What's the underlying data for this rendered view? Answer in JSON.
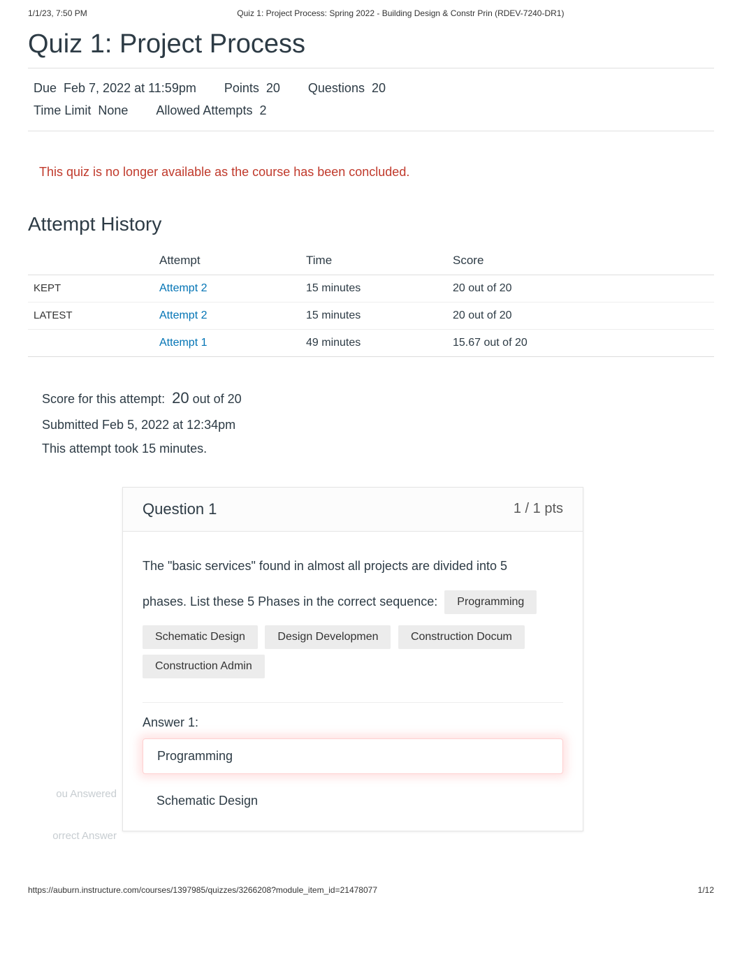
{
  "print": {
    "datetime": "1/1/23, 7:50 PM",
    "doc_title": "Quiz 1: Project Process: Spring 2022 - Building Design & Constr Prin (RDEV-7240-DR1)",
    "footer_url": "https://auburn.instructure.com/courses/1397985/quizzes/3266208?module_item_id=21478077",
    "footer_page": "1/12"
  },
  "page": {
    "title": "Quiz 1: Project Process"
  },
  "meta": {
    "due_label": "Due",
    "due_value": "Feb 7, 2022 at 11:59pm",
    "points_label": "Points",
    "points_value": "20",
    "questions_label": "Questions",
    "questions_value": "20",
    "timelimit_label": "Time Limit",
    "timelimit_value": "None",
    "allowed_label": "Allowed Attempts",
    "allowed_value": "2"
  },
  "alert": "This quiz is no longer available as the course has been concluded.",
  "history": {
    "title": "Attempt History",
    "headers": {
      "blank": "",
      "attempt": "Attempt",
      "time": "Time",
      "score": "Score"
    },
    "rows": [
      {
        "tag": "KEPT",
        "attempt": "Attempt 2",
        "time": "15 minutes",
        "score": "20 out of 20"
      },
      {
        "tag": "LATEST",
        "attempt": "Attempt 2",
        "time": "15 minutes",
        "score": "20 out of 20"
      },
      {
        "tag": "",
        "attempt": "Attempt 1",
        "time": "49 minutes",
        "score": "15.67 out of 20"
      }
    ]
  },
  "summary": {
    "score_prefix": "Score for this attempt:",
    "score_big": "20",
    "score_suffix": "out of 20",
    "submitted": "Submitted Feb 5, 2022 at 12:34pm",
    "duration": "This attempt took 15 minutes."
  },
  "question": {
    "title": "Question 1",
    "pts": "1 / 1 pts",
    "text_line1": "The \"basic services\" found in almost all projects are divided into 5",
    "text_line2": "phases. List these 5 Phases in the correct sequence:",
    "chips": {
      "c0": "Programming",
      "c1": "Schematic Design",
      "c2": "Design Developmen",
      "c3": "Construction Docum",
      "c4": "Construction Admin"
    },
    "answer1_heading": "Answer 1:",
    "you_answered_label": "ou Answered",
    "you_answered_value": "Programming",
    "correct_label": "orrect Answer",
    "correct_value": "Schematic Design"
  }
}
